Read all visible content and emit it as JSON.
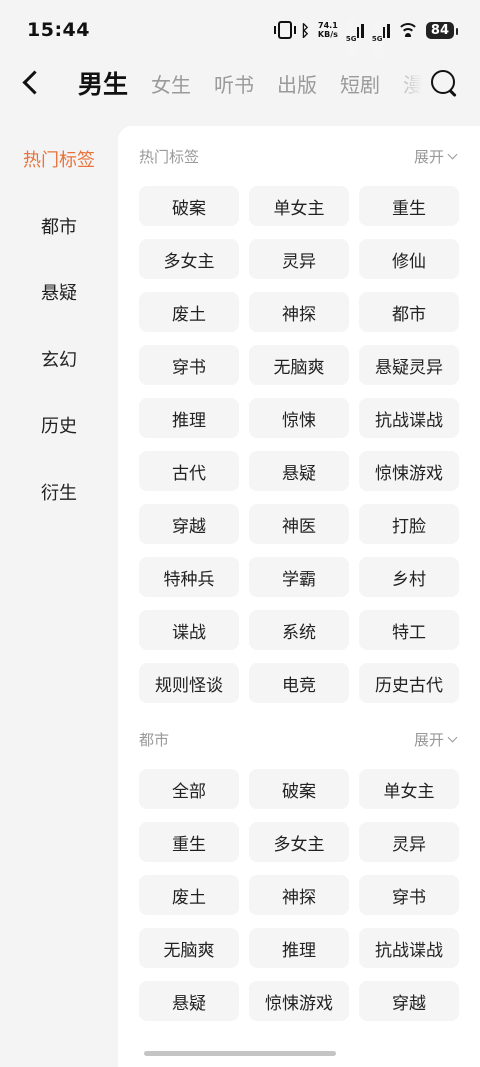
{
  "status": {
    "time": "15:44",
    "speed_value": "74.1",
    "speed_unit": "KB/s",
    "signal1_label": "5G",
    "signal2_label": "5G",
    "battery": "84"
  },
  "nav": {
    "tabs": [
      "男生",
      "女生",
      "听书",
      "出版",
      "短剧",
      "漫"
    ]
  },
  "sidebar": {
    "items": [
      "热门标签",
      "都市",
      "悬疑",
      "玄幻",
      "历史",
      "衍生"
    ]
  },
  "sections": [
    {
      "title": "热门标签",
      "expand_label": "展开",
      "tags": [
        "破案",
        "单女主",
        "重生",
        "多女主",
        "灵异",
        "修仙",
        "废土",
        "神探",
        "都市",
        "穿书",
        "无脑爽",
        "悬疑灵异",
        "推理",
        "惊悚",
        "抗战谍战",
        "古代",
        "悬疑",
        "惊悚游戏",
        "穿越",
        "神医",
        "打脸",
        "特种兵",
        "学霸",
        "乡村",
        "谍战",
        "系统",
        "特工",
        "规则怪谈",
        "电竞",
        "历史古代"
      ]
    },
    {
      "title": "都市",
      "expand_label": "展开",
      "tags": [
        "全部",
        "破案",
        "单女主",
        "重生",
        "多女主",
        "灵异",
        "废土",
        "神探",
        "穿书",
        "无脑爽",
        "推理",
        "抗战谍战",
        "悬疑",
        "惊悚游戏",
        "穿越"
      ]
    }
  ]
}
